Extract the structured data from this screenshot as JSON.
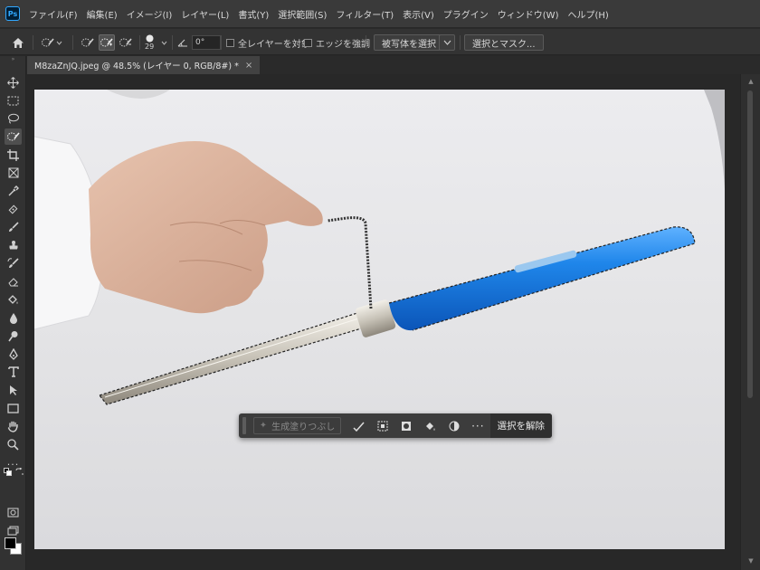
{
  "app": {
    "logo_text": "Ps"
  },
  "menu": [
    "ファイル(F)",
    "編集(E)",
    "イメージ(I)",
    "レイヤー(L)",
    "書式(Y)",
    "選択範囲(S)",
    "フィルター(T)",
    "表示(V)",
    "プラグイン",
    "ウィンドウ(W)",
    "ヘルプ(H)"
  ],
  "options": {
    "brush_size": "29",
    "angle_value": "0°",
    "sample_all_layers_label": "全レイヤーを対象",
    "enhance_edge_label": "エッジを強調",
    "select_subject_label": "被写体を選択",
    "select_and_mask_label": "選択とマスク..."
  },
  "document": {
    "tab_title": "M8zaZnJQ.jpeg @ 48.5% (レイヤー 0, RGB/8#) *",
    "close_glyph": "×"
  },
  "taskbar": {
    "generative_fill_label": "生成塗りつぶし",
    "more_label": "···",
    "deselect_label": "選択を解除"
  },
  "colors": {
    "ps_blue": "#31a8ff",
    "foreground": "#000000",
    "background": "#ffffff",
    "tube_blue": "#1f7fe0"
  },
  "icons": {
    "toolbar": [
      "move-icon",
      "marquee-icon",
      "lasso-icon",
      "quick-selection-icon",
      "crop-icon",
      "frame-icon",
      "eyedropper-icon",
      "spot-healing-icon",
      "brush-icon",
      "clone-stamp-icon",
      "history-brush-icon",
      "eraser-icon",
      "paint-bucket-icon",
      "blur-icon",
      "dodge-icon",
      "pen-icon",
      "type-icon",
      "path-selection-icon",
      "rectangle-icon",
      "hand-icon",
      "zoom-icon",
      "more-tools-icon"
    ]
  }
}
